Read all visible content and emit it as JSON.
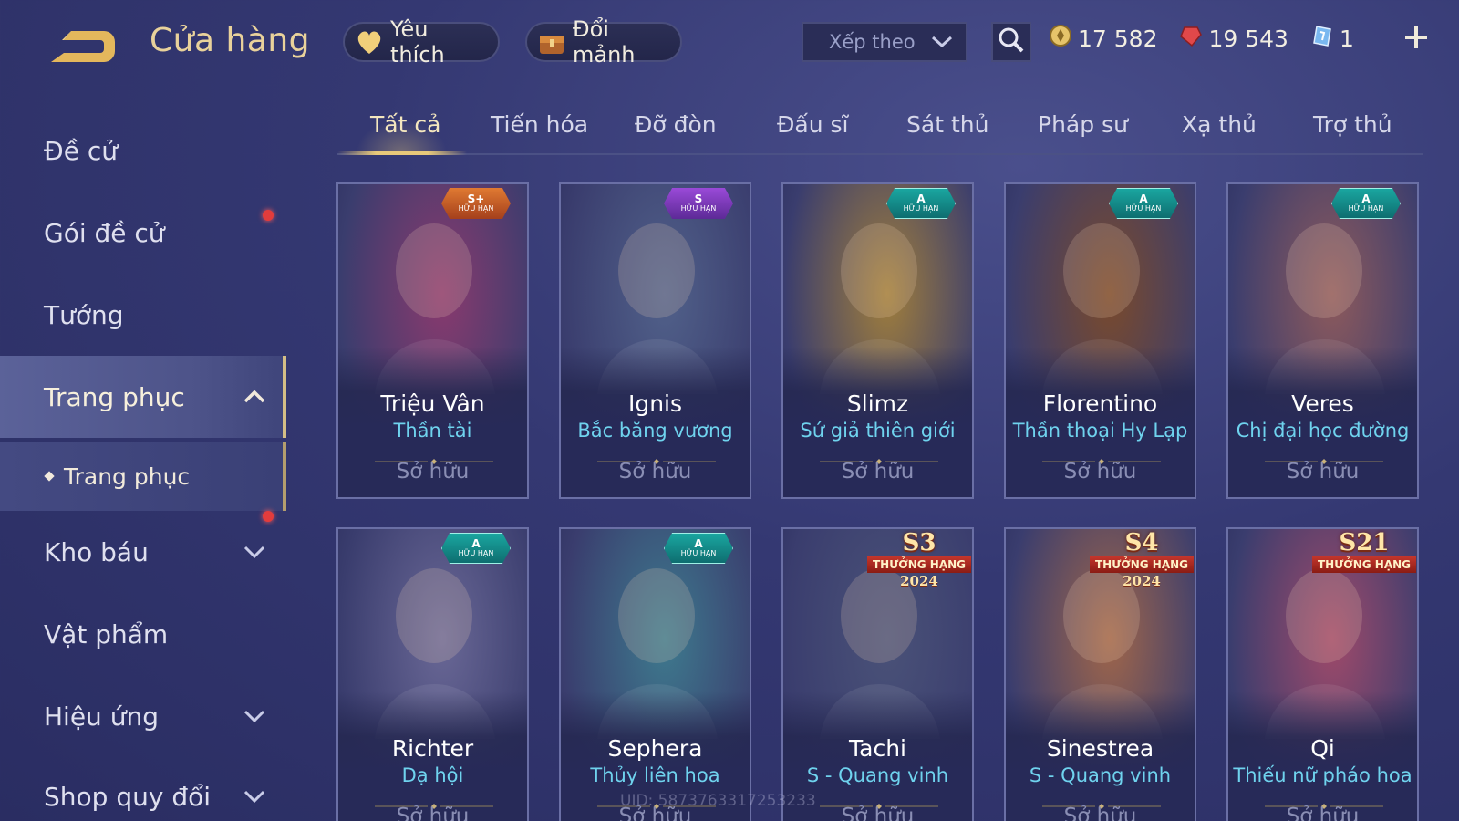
{
  "header": {
    "title": "Cửa hàng",
    "favorite_label": "Yêu thích",
    "swap_label": "Đổi mảnh",
    "sort_label": "Xếp theo",
    "currencies": [
      {
        "name": "vang",
        "value": "17 582",
        "color": "#e6c46a",
        "icon": "gold-coin-icon"
      },
      {
        "name": "quan-huy",
        "value": "19 543",
        "color": "#e0484a",
        "icon": "red-gem-icon"
      },
      {
        "name": "the",
        "value": "1",
        "color": "#7ab8f0",
        "icon": "ticket-icon"
      }
    ]
  },
  "sidebar": {
    "items": [
      {
        "label": "Đề cử"
      },
      {
        "label": "Gói đề cử"
      },
      {
        "label": "Tướng"
      },
      {
        "label": "Trang phục"
      },
      {
        "label": "Trang phục"
      },
      {
        "label": "Kho báu"
      },
      {
        "label": "Vật phẩm"
      },
      {
        "label": "Hiệu ứng"
      },
      {
        "label": "Shop quy đổi"
      }
    ]
  },
  "tabs": [
    {
      "label": "Tất cả"
    },
    {
      "label": "Tiến hóa"
    },
    {
      "label": "Đỡ đòn"
    },
    {
      "label": "Đấu sĩ"
    },
    {
      "label": "Sát thủ"
    },
    {
      "label": "Pháp sư"
    },
    {
      "label": "Xạ thủ"
    },
    {
      "label": "Trợ thủ"
    }
  ],
  "cards": [
    {
      "hero": "Triệu Vân",
      "skin": "Thần tài",
      "status": "Sở hữu",
      "badge_tier": "S+",
      "badge_label": "HỮU HẠN",
      "art_color": "#8a3a6e"
    },
    {
      "hero": "Ignis",
      "skin": "Bắc băng vương",
      "status": "Sở hữu",
      "badge_tier": "S",
      "badge_label": "HỮU HẠN",
      "art_color": "#51618a"
    },
    {
      "hero": "Slimz",
      "skin": "Sứ giả thiên giới",
      "status": "Sở hữu",
      "badge_tier": "A",
      "badge_label": "HỮU HẠN",
      "art_color": "#a07e3c"
    },
    {
      "hero": "Florentino",
      "skin": "Thần thoại Hy Lạp",
      "status": "Sở hữu",
      "badge_tier": "A",
      "badge_label": "HỮU HẠN",
      "art_color": "#7a4a2c"
    },
    {
      "hero": "Veres",
      "skin": "Chị đại học đường",
      "status": "Sở hữu",
      "badge_tier": "A",
      "badge_label": "HỮU HẠN",
      "art_color": "#8e5a5c"
    },
    {
      "hero": "Richter",
      "skin": "Dạ hội",
      "status": "Sở hữu",
      "badge_tier": "A",
      "badge_label": "HỮU HẠN",
      "art_color": "#6a6896"
    },
    {
      "hero": "Sephera",
      "skin": "Thủy liên hoa",
      "status": "Sở hữu",
      "badge_tier": "A",
      "badge_label": "HỮU HẠN",
      "art_color": "#3e7a8e"
    },
    {
      "hero": "Tachi",
      "skin": "S - Quang vinh",
      "status": "Sở hữu",
      "rank_season": "S3",
      "rank_title": "THƯỞNG HẠNG",
      "rank_year": "2024",
      "art_color": "#4a5278"
    },
    {
      "hero": "Sinestrea",
      "skin": "S - Quang vinh",
      "status": "Sở hữu",
      "rank_season": "S4",
      "rank_title": "THƯỞNG HẠNG",
      "rank_year": "2024",
      "art_color": "#a0664a"
    },
    {
      "hero": "Qi",
      "skin": "Thiếu nữ pháo hoa",
      "status": "Sở hữu",
      "rank_season": "S21",
      "rank_title": "THƯỞNG HẠNG",
      "art_color": "#a04a6a"
    }
  ],
  "watermark": "UID: 5873763317253233",
  "colors": {
    "accent_gold": "#e9d29b",
    "skin_cyan": "#6fd3ee",
    "badge_a": "#1aa6a0",
    "badge_s": "#9a4ad8",
    "badge_splus": "#e07a32"
  }
}
